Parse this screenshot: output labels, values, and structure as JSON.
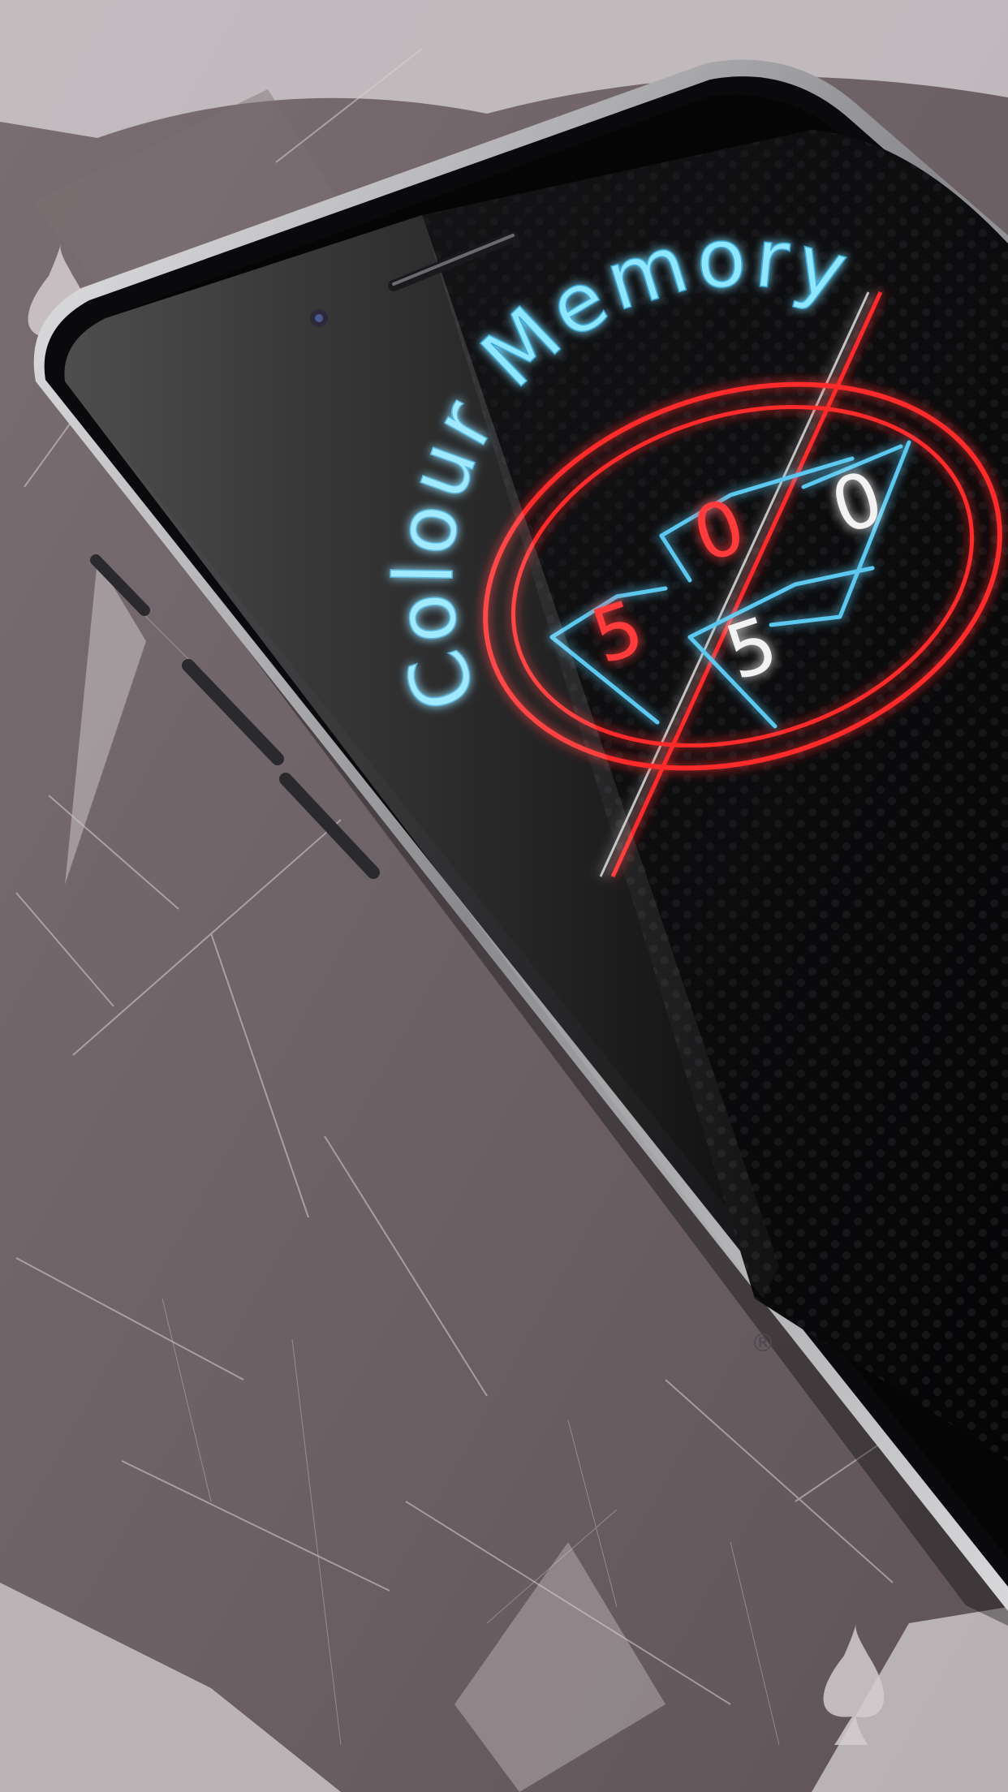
{
  "game": {
    "title": "Colour Memory",
    "logo_digits": [
      {
        "text": "5",
        "color": "#ff3a3a"
      },
      {
        "text": "0",
        "color": "#ff3a3a"
      },
      {
        "text": "0",
        "color": "#f2f2f2"
      },
      {
        "text": "5",
        "color": "#f2f2f2"
      }
    ],
    "registered_mark": "®"
  },
  "colors": {
    "neon_blue": "#6fd8ff",
    "neon_red": "#ff2a2a",
    "backdrop": "#6f6367",
    "backdrop_light": "#c9c3c6",
    "phone_frame": "#0a0a0c"
  },
  "icons": {
    "background_card": "spade-icon",
    "phone_speaker": "speaker-icon",
    "phone_camera": "camera-icon"
  }
}
